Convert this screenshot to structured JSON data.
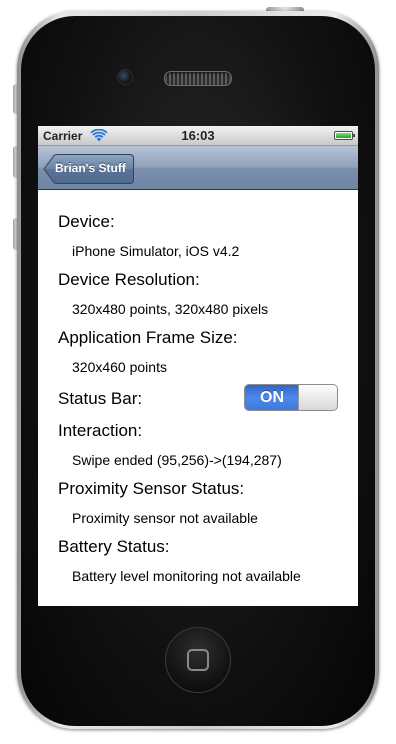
{
  "status_bar": {
    "carrier": "Carrier",
    "time": "16:03",
    "wifi_icon": "wifi-icon",
    "battery_icon": "battery-icon",
    "battery_level": 1.0,
    "battery_color": "#2eb82e"
  },
  "nav_bar": {
    "back_label": "Brian's Stuff",
    "tint": "#7a8fac"
  },
  "sections": {
    "device": {
      "heading": "Device:",
      "value": "iPhone Simulator, iOS v4.2"
    },
    "resolution": {
      "heading": "Device Resolution:",
      "value": "320x480 points, 320x480 pixels"
    },
    "frame_size": {
      "heading": "Application Frame Size:",
      "value": "320x460 points"
    },
    "status_bar": {
      "heading": "Status Bar:",
      "switch_label": "ON",
      "switch_on": true,
      "switch_color": "#3c78de"
    },
    "interaction": {
      "heading": "Interaction:",
      "value": "Swipe ended (95,256)->(194,287)"
    },
    "proximity": {
      "heading": "Proximity Sensor Status:",
      "value": "Proximity sensor not available"
    },
    "battery": {
      "heading": "Battery Status:",
      "value": "Battery level monitoring not available"
    }
  },
  "hardware": {
    "home_icon": "home-square-icon"
  }
}
